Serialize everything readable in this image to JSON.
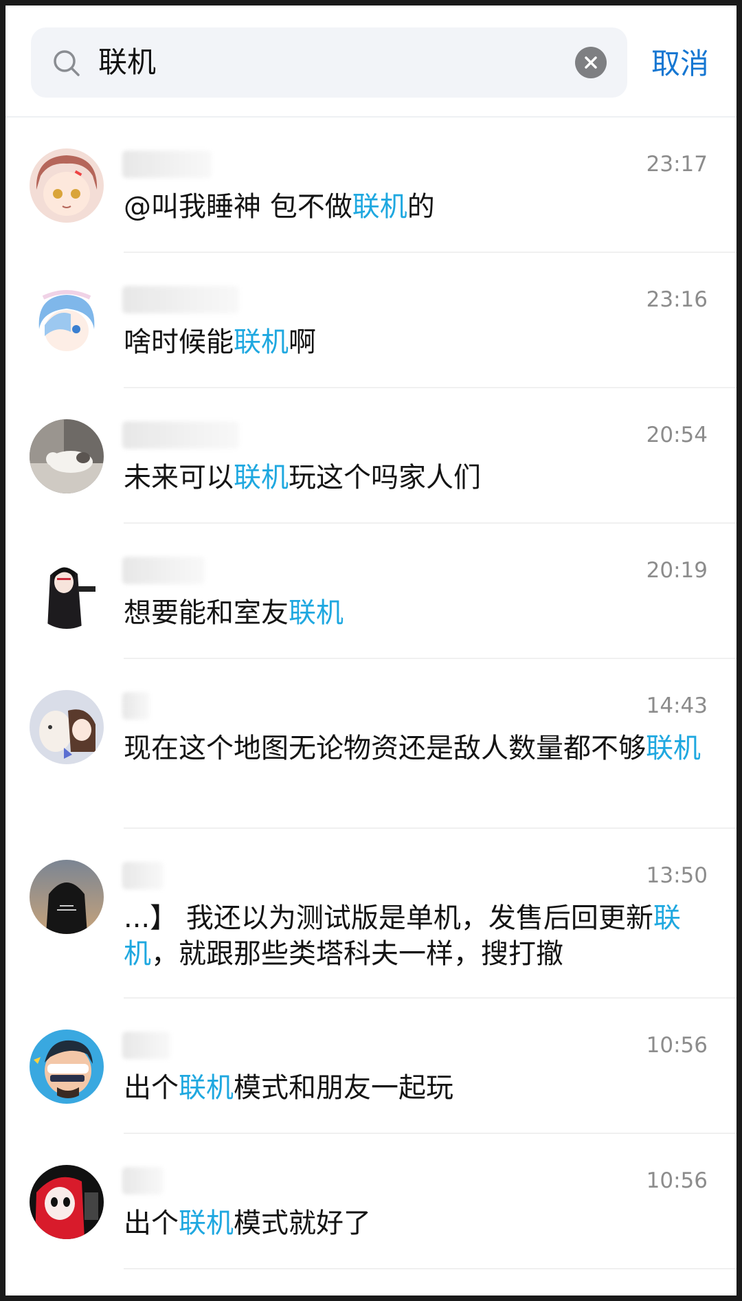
{
  "search": {
    "query": "联机",
    "cancel_label": "取消"
  },
  "results": [
    {
      "time": "23:17",
      "pre": "@叫我睡神  包不做",
      "hl": "联机",
      "post": "的"
    },
    {
      "time": "23:16",
      "pre": "啥时候能",
      "hl": "联机",
      "post": "啊"
    },
    {
      "time": "20:54",
      "pre": "未来可以",
      "hl": "联机",
      "post": "玩这个吗家人们"
    },
    {
      "time": "20:19",
      "pre": "想要能和室友",
      "hl": "联机",
      "post": ""
    },
    {
      "time": "14:43",
      "pre": "现在这个地图无论物资还是敌人数量都不够",
      "hl": "联机",
      "post": ""
    },
    {
      "time": "13:50",
      "pre": "...】 我还以为测试版是单机，发售后回更新",
      "hl": "联机",
      "post": "，就跟那些类塔科夫一样，搜打撤"
    },
    {
      "time": "10:56",
      "pre": "出个",
      "hl": "联机",
      "post": "模式和朋友一起玩"
    },
    {
      "time": "10:56",
      "pre": "出个",
      "hl": "联机",
      "post": "模式就好了"
    }
  ],
  "colors": {
    "accent": "#1677d2",
    "highlight": "#1fa8e0",
    "time": "#8c8c8c"
  }
}
